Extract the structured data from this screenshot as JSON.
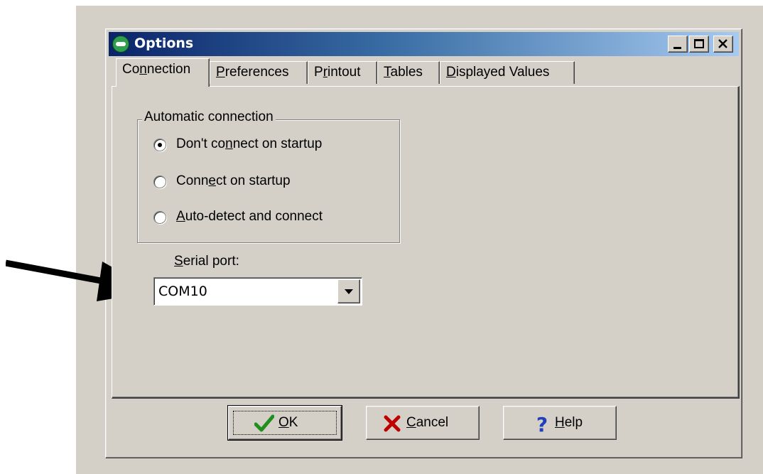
{
  "window": {
    "title": "Options"
  },
  "tabs": [
    {
      "label": "Connection",
      "accel_index": 2,
      "active": true
    },
    {
      "label": "Preferences",
      "accel_index": 0,
      "active": false
    },
    {
      "label": "Printout",
      "accel_index": 1,
      "active": false
    },
    {
      "label": "Tables",
      "accel_index": 0,
      "active": false
    },
    {
      "label": "Displayed Values",
      "accel_index": 0,
      "active": false
    }
  ],
  "connection": {
    "group_label": "Automatic connection",
    "options": [
      {
        "label": "Don't connect on startup",
        "accel_index": 8,
        "checked": true
      },
      {
        "label": "Connect on startup",
        "accel_index": 4,
        "checked": false
      },
      {
        "label": "Auto-detect and connect",
        "accel_index": 0,
        "checked": false
      }
    ],
    "serial_port_label": "Serial port:",
    "serial_port_value": "COM10"
  },
  "buttons": {
    "ok": "OK",
    "cancel": "Cancel",
    "help": "Help"
  },
  "colors": {
    "dialog_face": "#d4d0c8",
    "title_start": "#0a246a",
    "title_end": "#a6caf0",
    "ok_check": "#1f8f1f",
    "cancel_x": "#c00000",
    "help_question": "#1f3fbf"
  },
  "icons": {
    "app": "app-logo-icon",
    "ok": "checkmark-icon",
    "cancel": "x-mark-icon",
    "help": "question-mark-icon",
    "annotation": "pointer-arrow-icon"
  }
}
